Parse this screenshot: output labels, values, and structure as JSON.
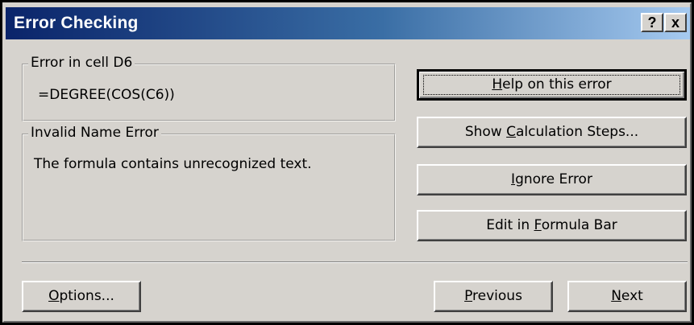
{
  "dialog": {
    "title": "Error Checking",
    "help_button_label": "?",
    "close_button_label": "x"
  },
  "error_cell": {
    "label": "Error in cell D6",
    "formula": "=DEGREE(COS(C6))"
  },
  "error_type": {
    "label": "Invalid Name Error",
    "description": "The formula contains unrecognized text."
  },
  "buttons": {
    "help_on_error": {
      "pre": "",
      "accel": "H",
      "post": "elp on this error"
    },
    "show_calc_steps": {
      "pre": "Show ",
      "accel": "C",
      "post": "alculation Steps..."
    },
    "ignore_error": {
      "pre": "",
      "accel": "I",
      "post": "gnore Error"
    },
    "edit_formula_bar": {
      "pre": "Edit in ",
      "accel": "F",
      "post": "ormula Bar"
    },
    "options": {
      "pre": "",
      "accel": "O",
      "post": "ptions..."
    },
    "previous": {
      "pre": "",
      "accel": "P",
      "post": "revious"
    },
    "next": {
      "pre": "",
      "accel": "N",
      "post": "ext"
    }
  },
  "colors": {
    "titlebar_start": "#0a246a",
    "titlebar_end": "#a6caf0",
    "face": "#d6d3ce"
  }
}
